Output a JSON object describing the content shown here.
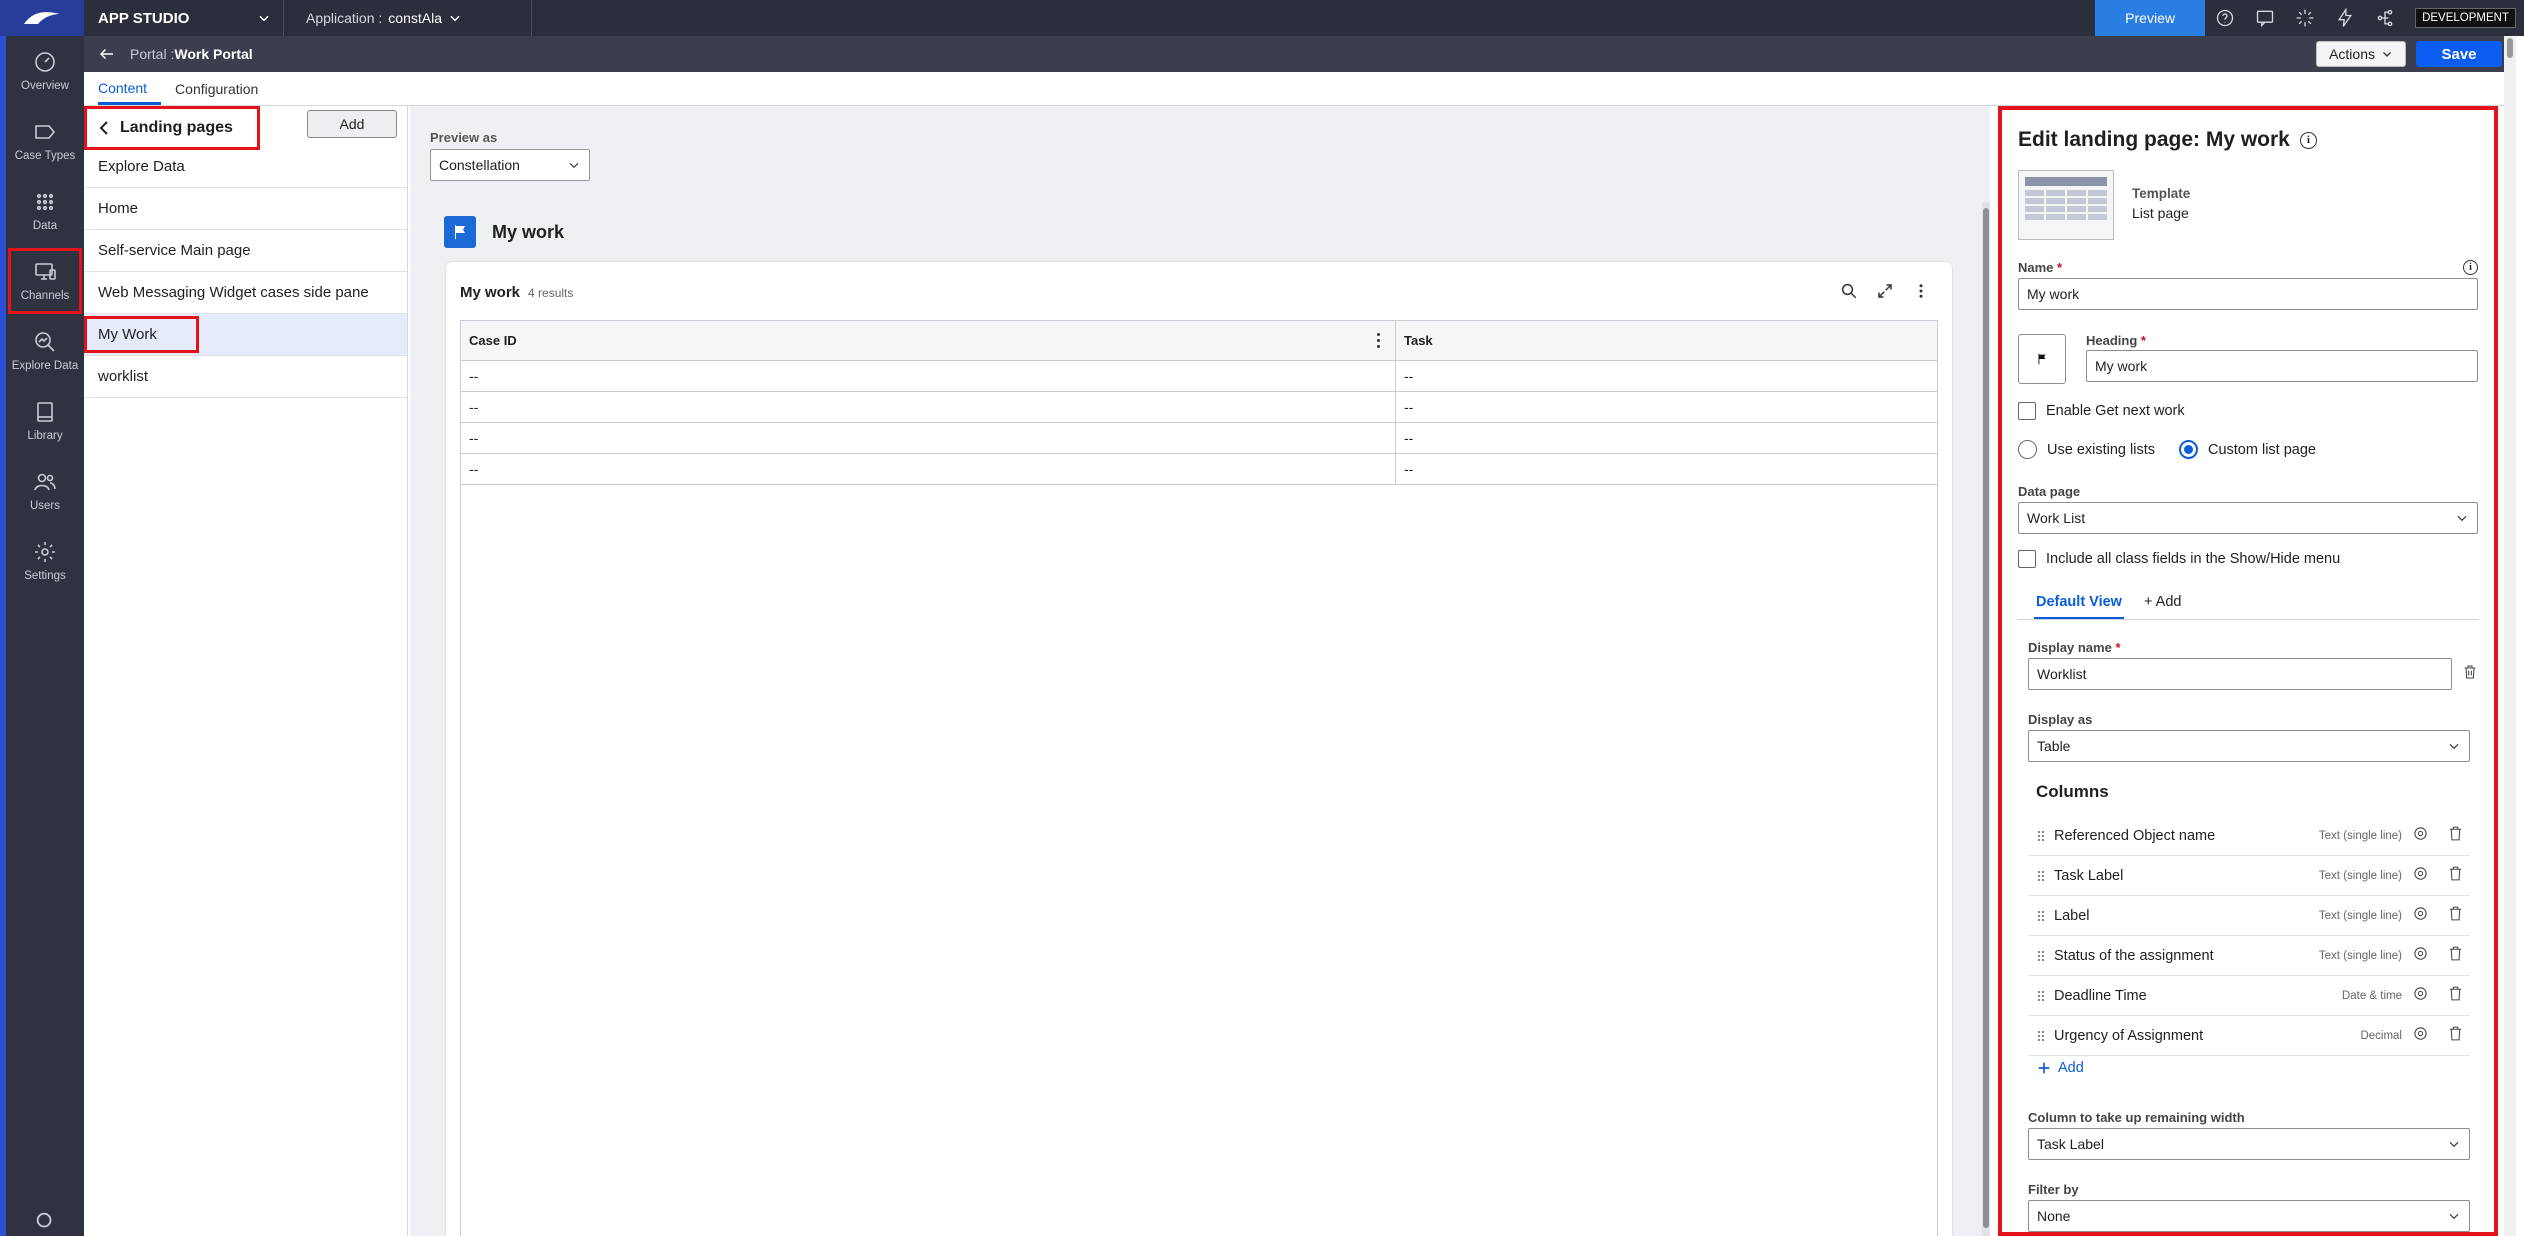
{
  "topbar": {
    "studio": "APP STUDIO",
    "app_label": "Application :",
    "app_value": "constAla",
    "preview": "Preview",
    "env_badge": "DEVELOPMENT",
    "icons": [
      "help-icon",
      "chat-icon",
      "spark-icon",
      "lightning-icon",
      "share-icon"
    ]
  },
  "rail": {
    "items": [
      {
        "label": "Overview",
        "icon": "gauge-icon"
      },
      {
        "label": "Case Types",
        "icon": "case-types-icon"
      },
      {
        "label": "Data",
        "icon": "grid-dots-icon"
      },
      {
        "label": "Channels",
        "icon": "monitor-icon",
        "highlighted": true
      },
      {
        "label": "Explore Data",
        "icon": "explore-icon"
      },
      {
        "label": "Library",
        "icon": "book-icon"
      },
      {
        "label": "Users",
        "icon": "users-icon"
      },
      {
        "label": "Settings",
        "icon": "gear-icon"
      }
    ]
  },
  "subheader": {
    "portal_label": "Portal :",
    "portal_value": "Work Portal",
    "actions": "Actions",
    "save": "Save"
  },
  "tabs": [
    {
      "label": "Content",
      "active": true
    },
    {
      "label": "Configuration",
      "active": false
    }
  ],
  "landing": {
    "title": "Landing pages",
    "add": "Add",
    "items": [
      {
        "label": "Explore Data"
      },
      {
        "label": "Home"
      },
      {
        "label": "Self-service Main page"
      },
      {
        "label": "Web Messaging Widget cases side pane"
      },
      {
        "label": "My Work",
        "selected": true
      },
      {
        "label": "worklist"
      }
    ]
  },
  "preview": {
    "label": "Preview as",
    "value": "Constellation",
    "page_title": "My work",
    "card_title": "My work",
    "result_count": "4 results",
    "columns": [
      "Case ID",
      "Task"
    ],
    "rows": [
      [
        "--",
        "--"
      ],
      [
        "--",
        "--"
      ],
      [
        "--",
        "--"
      ],
      [
        "--",
        "--"
      ]
    ]
  },
  "editor": {
    "title": "Edit landing page: My work",
    "template_label": "Template",
    "template_value": "List page",
    "name_label": "Name",
    "name_value": "My work",
    "heading_label": "Heading",
    "heading_value": "My work",
    "get_next_work": "Enable Get next work",
    "use_existing": "Use existing lists",
    "custom_list": "Custom list page",
    "data_page_label": "Data page",
    "data_page_value": "Work List",
    "include_fields": "Include all class fields in the Show/Hide menu",
    "view_tab": "Default View",
    "add_view": "+ Add",
    "display_name_label": "Display name",
    "display_name_value": "Worklist",
    "display_as_label": "Display as",
    "display_as_value": "Table",
    "columns_title": "Columns",
    "columns": [
      {
        "name": "Referenced Object name",
        "type": "Text (single line)"
      },
      {
        "name": "Task Label",
        "type": "Text (single line)"
      },
      {
        "name": "Label",
        "type": "Text (single line)"
      },
      {
        "name": "Status of the assignment",
        "type": "Text (single line)"
      },
      {
        "name": "Deadline Time",
        "type": "Date & time"
      },
      {
        "name": "Urgency of Assignment",
        "type": "Decimal"
      }
    ],
    "add_column": "Add",
    "remaining_width_label": "Column to take up remaining width",
    "remaining_width_value": "Task Label",
    "filter_label": "Filter by",
    "filter_value": "None"
  }
}
